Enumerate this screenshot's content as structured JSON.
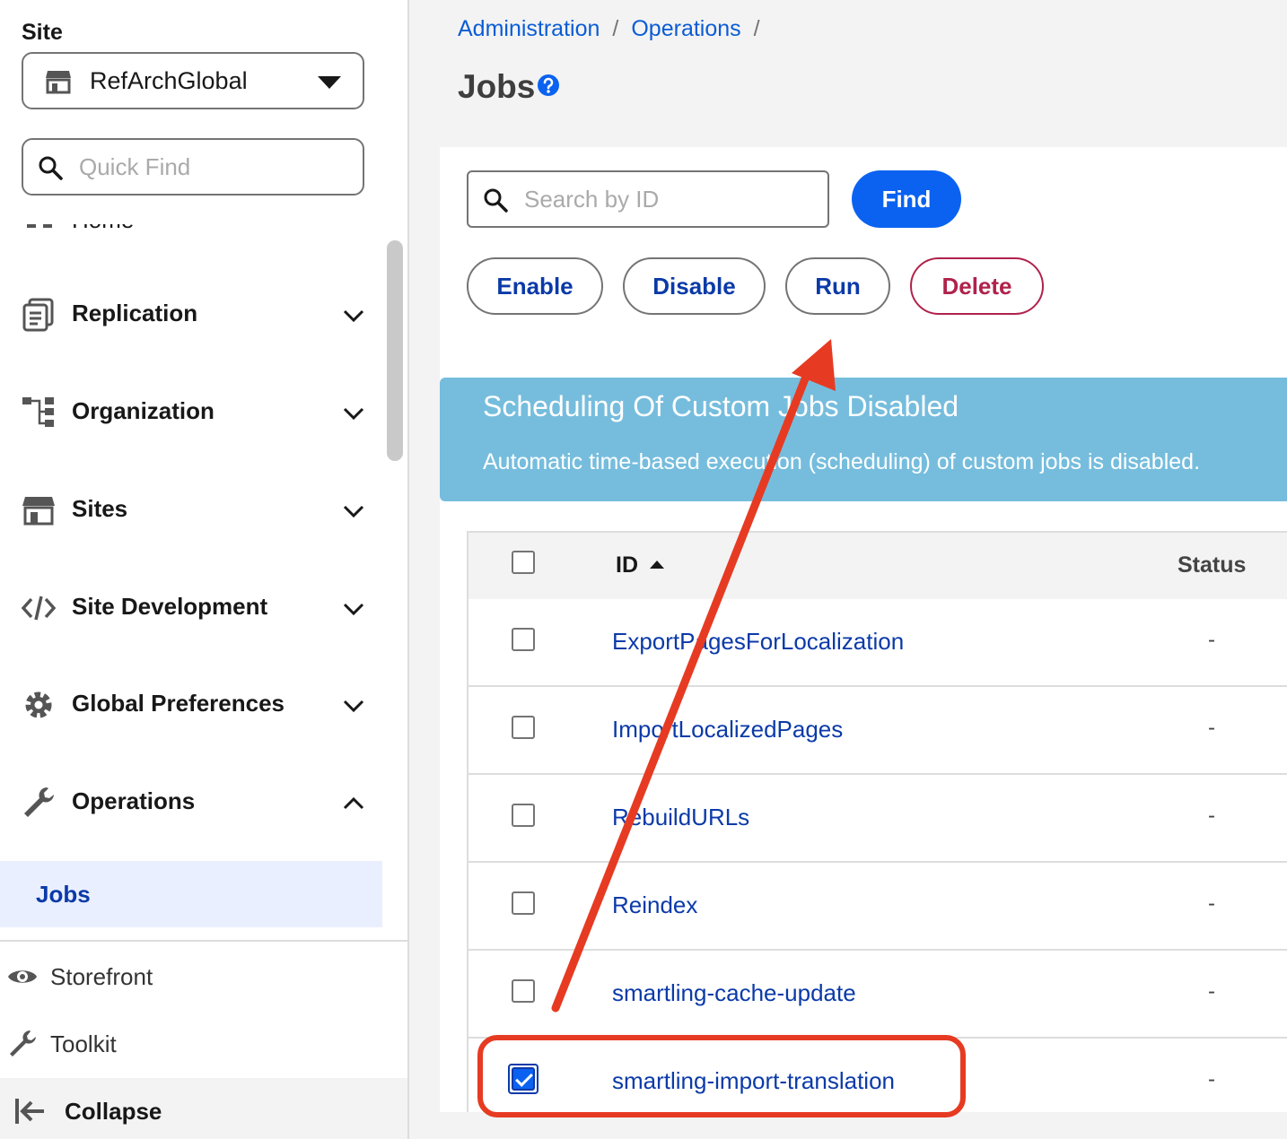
{
  "sidebar": {
    "site_label": "Site",
    "site_name": "RefArchGlobal",
    "quickfind_placeholder": "Quick Find",
    "home_label": "Home",
    "nav": [
      {
        "label": "Replication",
        "icon": "replication-icon",
        "expanded": false
      },
      {
        "label": "Organization",
        "icon": "hierarchy-icon",
        "expanded": false
      },
      {
        "label": "Sites",
        "icon": "store-icon",
        "expanded": false
      },
      {
        "label": "Site Development",
        "icon": "code-icon",
        "expanded": false
      },
      {
        "label": "Global Preferences",
        "icon": "gear-icon",
        "expanded": false
      },
      {
        "label": "Operations",
        "icon": "wrench-icon",
        "expanded": true
      }
    ],
    "sub_item": "Jobs",
    "footer": {
      "storefront": "Storefront",
      "toolkit": "Toolkit",
      "collapse": "Collapse"
    }
  },
  "breadcrumb": [
    "Administration",
    "Operations"
  ],
  "page": {
    "title": "Jobs"
  },
  "toolbar": {
    "search_placeholder": "Search by ID",
    "find": "Find",
    "enable": "Enable",
    "disable": "Disable",
    "run": "Run",
    "delete": "Delete"
  },
  "banner": {
    "title": "Scheduling Of Custom Jobs Disabled",
    "text": "Automatic time-based execution (scheduling) of custom jobs is disabled."
  },
  "table": {
    "columns": [
      "ID",
      "Status"
    ],
    "rows": [
      {
        "id": "ExportPagesForLocalization",
        "status": "-",
        "checked": false
      },
      {
        "id": "ImportLocalizedPages",
        "status": "-",
        "checked": false
      },
      {
        "id": "RebuildURLs",
        "status": "-",
        "checked": false
      },
      {
        "id": "Reindex",
        "status": "-",
        "checked": false
      },
      {
        "id": "smartling-cache-update",
        "status": "-",
        "checked": false
      },
      {
        "id": "smartling-import-translation",
        "status": "-",
        "checked": true
      }
    ]
  },
  "colors": {
    "accent": "#0b62f0",
    "link": "#0b3aa8",
    "banner": "#76bddd",
    "delete": "#b0224b",
    "annotation": "#e63b22"
  }
}
